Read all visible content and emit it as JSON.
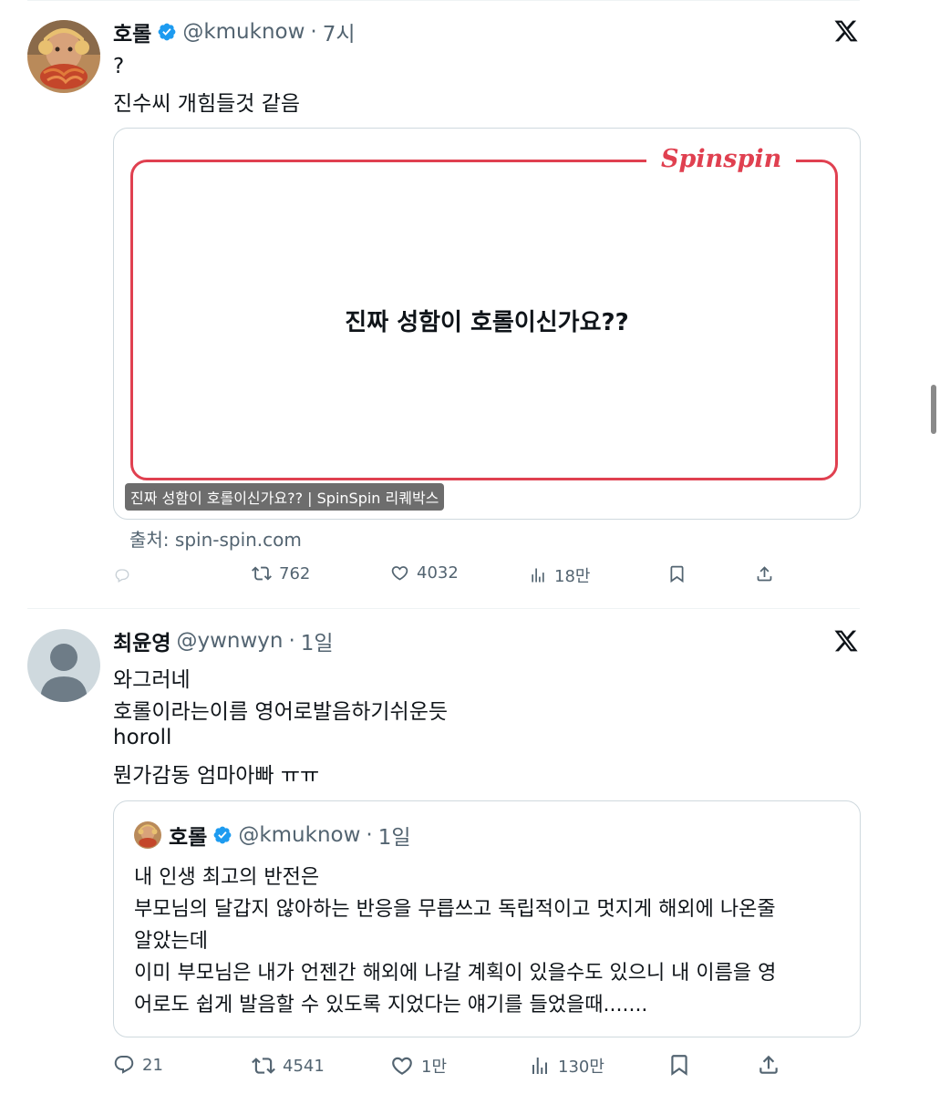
{
  "tweet1": {
    "name": "호롤",
    "handle": "@kmuknow",
    "time": "7시",
    "lines": [
      "?",
      "진수씨 개힘들것 같음"
    ],
    "card": {
      "brand": "Spinspin",
      "question": "진짜 성함이 호롤이신가요??",
      "caption": "진짜 성함이 호롤이신가요?? | SpinSpin 리퀘박스",
      "source": "출처: spin-spin.com"
    },
    "actions": {
      "retweets": "762",
      "likes": "4032",
      "views": "18만"
    }
  },
  "tweet2": {
    "name": "최윤영",
    "handle": "@ywnwyn",
    "time": "1일",
    "lines": [
      "와그러네",
      "호롤이라는이름 영어로발음하기쉬운듯",
      "horoll",
      "뭔가감동 엄마아빠 ㅠㅠ"
    ],
    "quote": {
      "name": "호롤",
      "handle": "@kmuknow",
      "time": "1일",
      "lines": [
        "내 인생 최고의 반전은",
        "부모님의 달갑지 않아하는 반응을 무릅쓰고 독립적이고 멋지게 해외에 나온줄",
        "알았는데",
        "이미 부모님은 내가 언젠간 해외에 나갈 계획이 있을수도 있으니 내 이름을 영",
        "어로도 쉽게 발음할 수 있도록 지었다는 얘기를 들었을때......."
      ]
    },
    "actions": {
      "replies": "21",
      "retweets": "4541",
      "likes": "1만",
      "views": "130만"
    }
  },
  "icons": {
    "verified": "verified-badge-icon",
    "x_logo": "x-logo-icon",
    "reply": "reply-icon",
    "retweet": "retweet-icon",
    "like": "heart-icon",
    "views": "views-icon",
    "bookmark": "bookmark-icon",
    "share": "share-icon"
  },
  "colors": {
    "brand_red": "#e04050",
    "verified": "#1d9bf0",
    "secondary_text": "#536471"
  }
}
